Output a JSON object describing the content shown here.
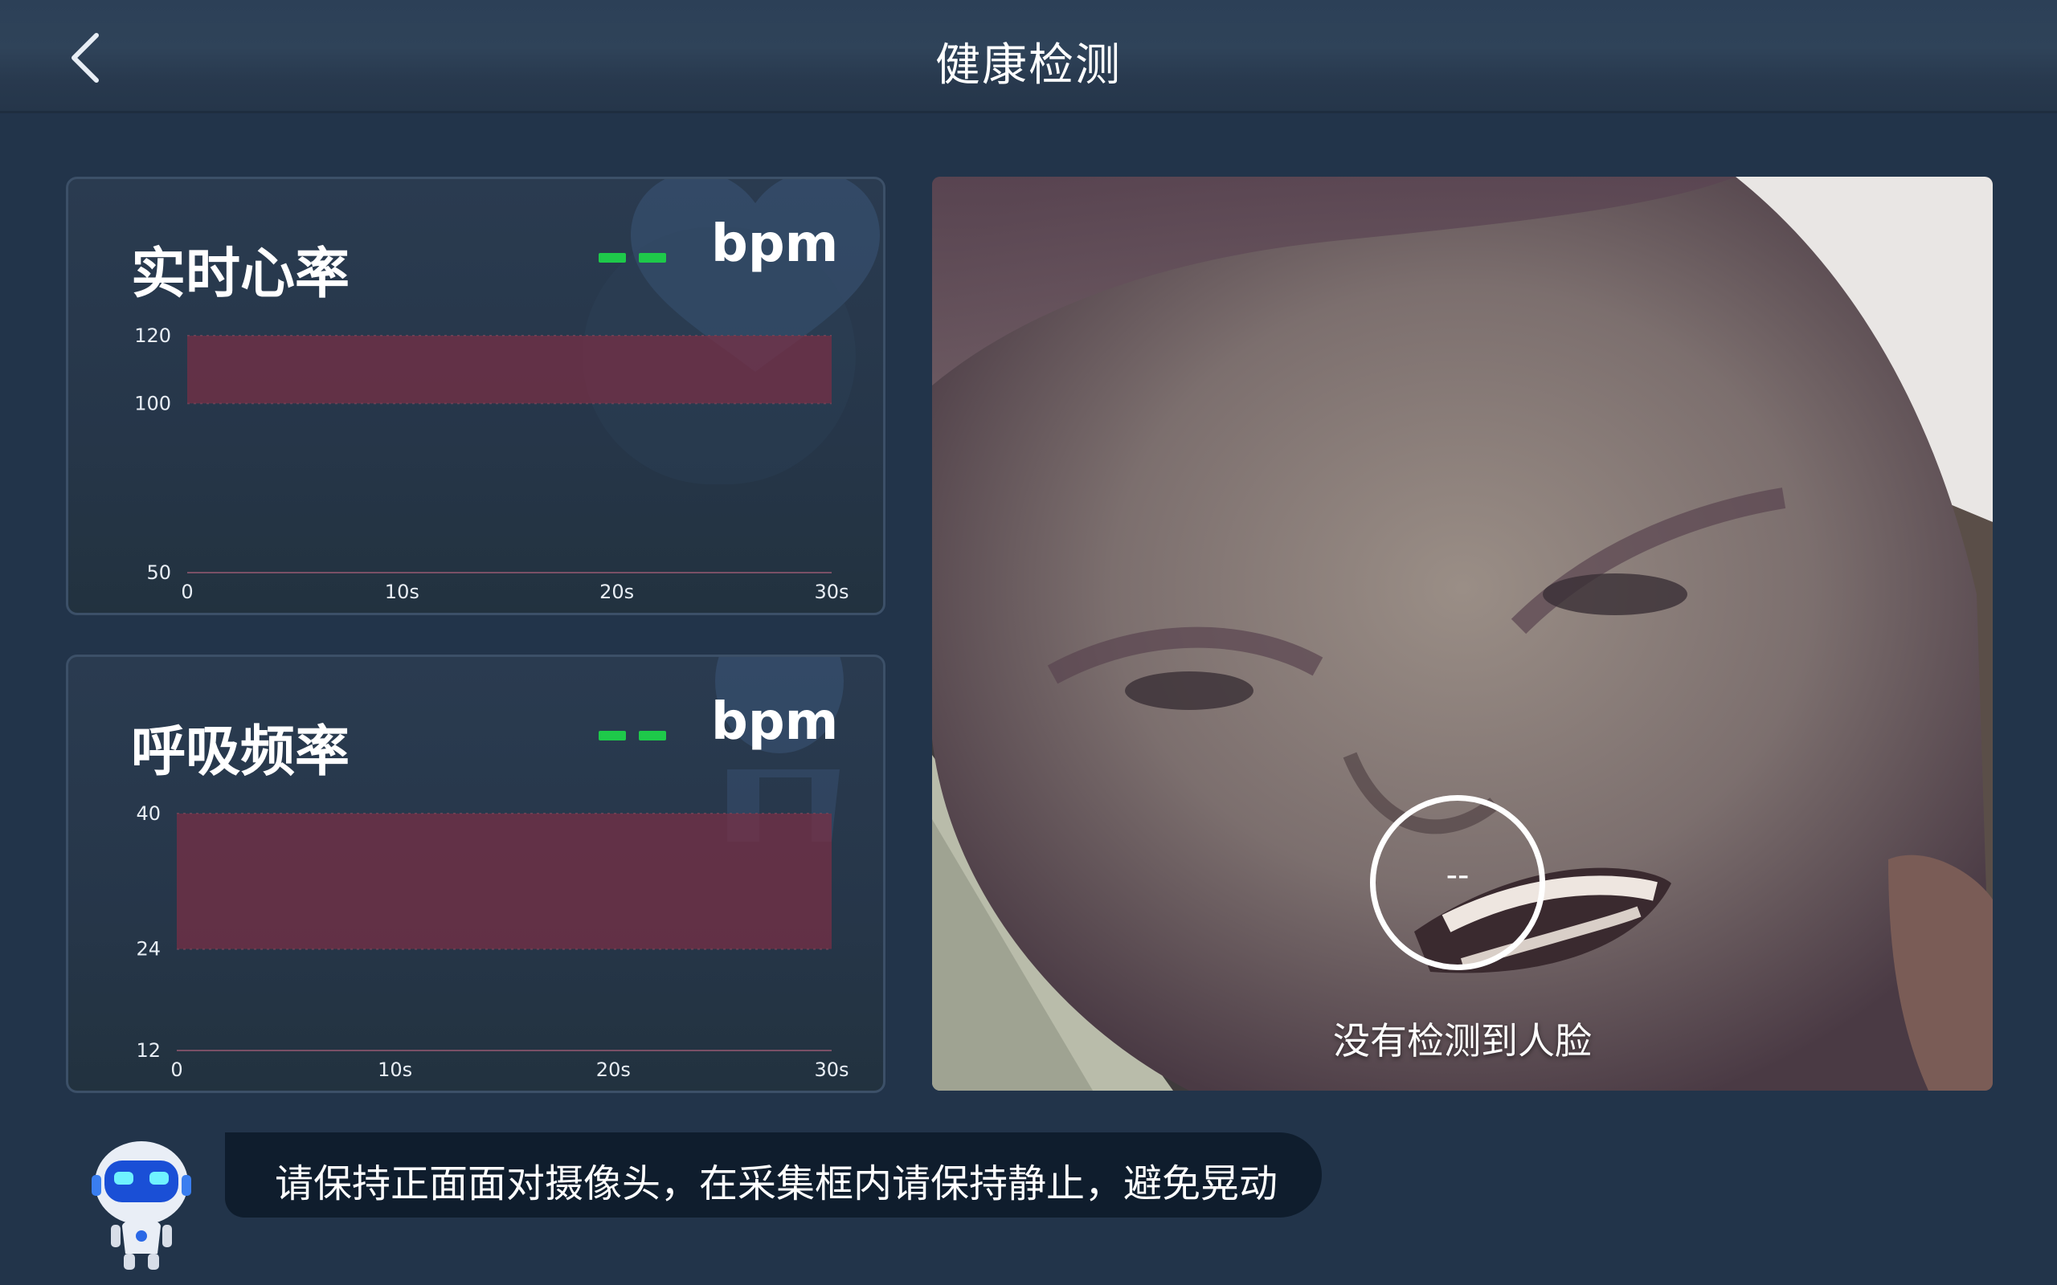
{
  "header": {
    "title": "健康检测"
  },
  "heart_rate": {
    "title": "实时心率",
    "value": "--",
    "unit": "bpm",
    "chart_data": {
      "type": "line",
      "title": "实时心率",
      "xlabel": "",
      "ylabel": "",
      "x_ticks": [
        "0",
        "10s",
        "20s",
        "30s"
      ],
      "y_ticks": [
        "120",
        "100",
        "50"
      ],
      "ylim": [
        50,
        120
      ],
      "xlim": [
        0,
        30
      ],
      "series": [],
      "highlight_band": [
        100,
        120
      ],
      "band_color": "#7a2f45"
    }
  },
  "breath_rate": {
    "title": "呼吸频率",
    "value": "--",
    "unit": "bpm",
    "chart_data": {
      "type": "line",
      "title": "呼吸频率",
      "xlabel": "",
      "ylabel": "",
      "x_ticks": [
        "0",
        "10s",
        "20s",
        "30s"
      ],
      "y_ticks": [
        "40",
        "24",
        "12"
      ],
      "ylim": [
        12,
        40
      ],
      "xlim": [
        0,
        30
      ],
      "series": [],
      "highlight_band": [
        24,
        40
      ],
      "band_color": "#7a2f45"
    }
  },
  "camera": {
    "face_value": "--",
    "status": "没有检测到人脸"
  },
  "tip": {
    "text": "请保持正面面对摄像头，在采集框内请保持静止，避免晃动"
  },
  "colors": {
    "accent_green": "#1ec94a",
    "background": "#22344a",
    "band": "#7a2f45"
  }
}
